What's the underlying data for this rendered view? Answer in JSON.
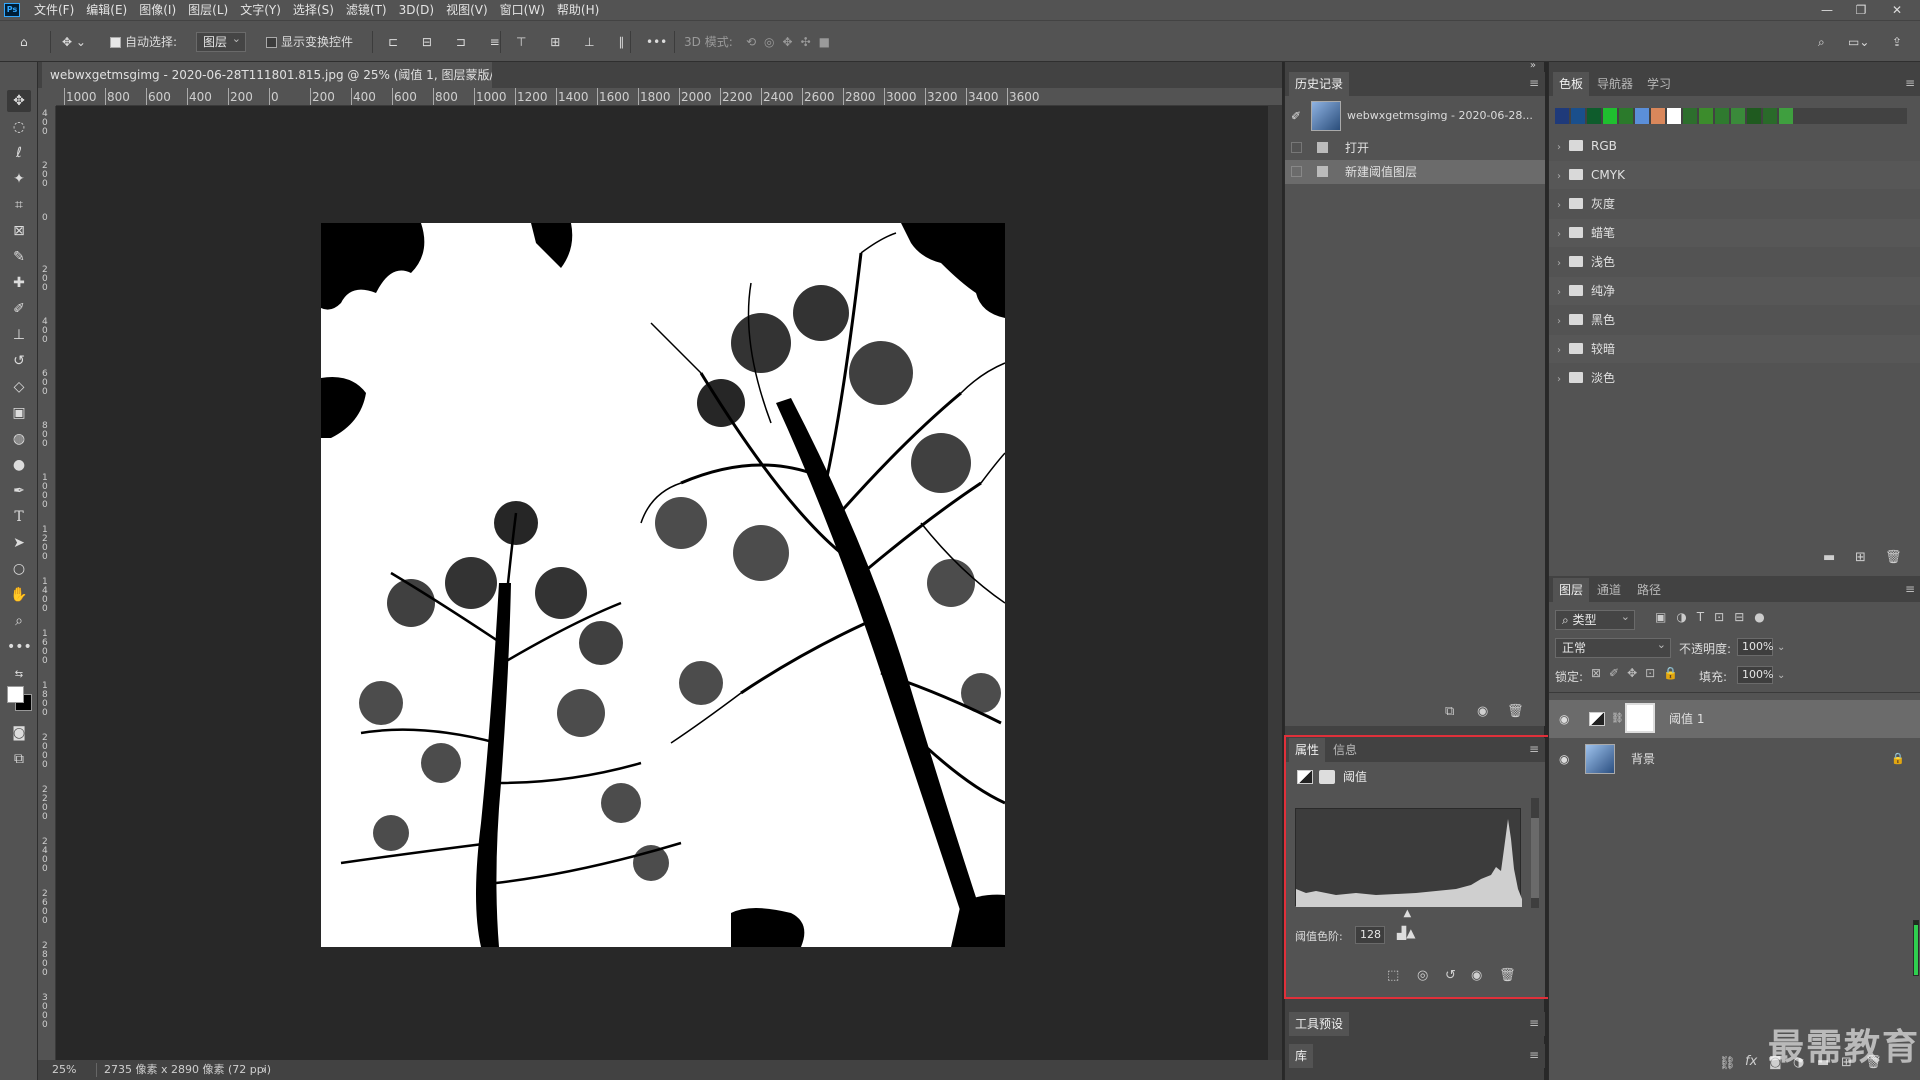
{
  "app": {
    "logo": "Ps"
  },
  "menu": [
    "文件(F)",
    "编辑(E)",
    "图像(I)",
    "图层(L)",
    "文字(Y)",
    "选择(S)",
    "滤镜(T)",
    "3D(D)",
    "视图(V)",
    "窗口(W)",
    "帮助(H)"
  ],
  "window_controls": [
    "—",
    "❐",
    "✕"
  ],
  "options": {
    "auto_select_label": "自动选择:",
    "auto_select_value": "图层",
    "show_transform_label": "显示变换控件",
    "mode_3d_label": "3D 模式:"
  },
  "document": {
    "tab_title": "webwxgetmsgimg - 2020-06-28T111801.815.jpg @ 25% (阈值 1, 图层蒙版/8) *",
    "close": "×"
  },
  "ruler": {
    "h_labels": [
      "1000",
      "800",
      "600",
      "400",
      "200",
      "0",
      "200",
      "400",
      "600",
      "800",
      "1000",
      "1200",
      "1400",
      "1600",
      "1800",
      "2000",
      "2200",
      "2400",
      "2600",
      "2800",
      "3000",
      "3200",
      "3400",
      "3600"
    ],
    "v_labels": [
      "4 0 0",
      "2 0 0",
      "0",
      "2 0 0",
      "4 0 0",
      "6 0 0",
      "8 0 0",
      "1 0 0 0",
      "1 2 0 0",
      "1 4 0 0",
      "1 6 0 0",
      "1 8 0 0",
      "2 0 0 0",
      "2 2 0 0",
      "2 4 0 0",
      "2 6 0 0",
      "2 8 0 0",
      "3 0 0 0"
    ]
  },
  "status": {
    "zoom": "25%",
    "info": "2735 像素 x 2890 像素 (72 ppi)",
    "arrow": "›"
  },
  "history": {
    "tab": "历史记录",
    "snapshot": "webwxgetmsgimg - 2020-06-28...",
    "items": [
      {
        "label": "打开",
        "selected": false
      },
      {
        "label": "新建阈值图层",
        "selected": true
      }
    ]
  },
  "properties": {
    "tabs": [
      "属性",
      "信息"
    ],
    "title": "阈值",
    "threshold_label": "阈值色阶:",
    "threshold_value": "128",
    "threshold_level": 128
  },
  "collapsed_panels": [
    "工具预设",
    "库"
  ],
  "swatches": {
    "tabs": [
      "色板",
      "导航器",
      "学习"
    ],
    "colors": [
      "#1f3a7a",
      "#1a4f8c",
      "#0e5c2c",
      "#1fbf2f",
      "#2b7a2b",
      "#5b8fd9",
      "#d9875b",
      "#ffffff",
      "#2d6e2d",
      "#3c8c2c",
      "#2f7a2f",
      "#3a8a3a",
      "#1f5a1f",
      "#2a6a2a",
      "#3f9f3f"
    ],
    "groups": [
      "RGB",
      "CMYK",
      "灰度",
      "蜡笔",
      "浅色",
      "纯净",
      "黑色",
      "较暗",
      "淡色"
    ]
  },
  "layers": {
    "tabs": [
      "图层",
      "通道",
      "路径"
    ],
    "filter_label": "类型",
    "blend_mode": "正常",
    "opacity_label": "不透明度:",
    "opacity_value": "100%",
    "lock_label": "锁定:",
    "fill_label": "填充:",
    "fill_value": "100%",
    "items": [
      {
        "name": "阈值 1",
        "selected": true
      },
      {
        "name": "背景",
        "selected": false
      }
    ]
  },
  "watermark": "最需教育",
  "colors": {
    "highlight": "#e0303a",
    "panel": "#535353",
    "dark": "#424242",
    "canvas": "#282828"
  }
}
